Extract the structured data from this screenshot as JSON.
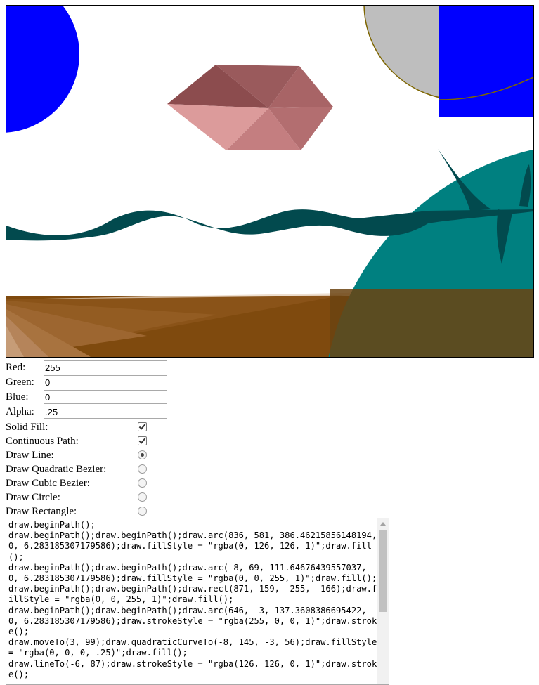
{
  "canvas": {
    "colors": {
      "teal": "#008080",
      "dark_teal": "#024a4e",
      "blue": "#0000ff",
      "dark_blue": "#0000b4",
      "gray": "#bebebe",
      "olive_stroke": "#7e7e00",
      "brown": "#7f4a0e",
      "hex_top": "#8c4c4e",
      "hex_light": "#dc9b9b"
    }
  },
  "form": {
    "red": {
      "label": "Red:",
      "value": "255"
    },
    "green": {
      "label": "Green:",
      "value": "0"
    },
    "blue": {
      "label": "Blue:",
      "value": "0"
    },
    "alpha": {
      "label": "Alpha:",
      "value": ".25"
    }
  },
  "options": {
    "solid_fill": {
      "label": "Solid Fill:",
      "checked": true
    },
    "continuous_path": {
      "label": "Continuous Path:",
      "checked": true
    },
    "draw_line": {
      "label": "Draw Line:",
      "selected": true
    },
    "draw_quadratic": {
      "label": "Draw Quadratic Bezier:",
      "selected": false
    },
    "draw_cubic": {
      "label": "Draw Cubic Bezier:",
      "selected": false
    },
    "draw_circle": {
      "label": "Draw Circle:",
      "selected": false
    },
    "draw_rectangle": {
      "label": "Draw Rectangle:",
      "selected": false
    }
  },
  "code_output": "draw.beginPath();\ndraw.beginPath();draw.beginPath();draw.arc(836, 581, 386.46215856148194, 0, 6.283185307179586);draw.fillStyle = \"rgba(0, 126, 126, 1)\";draw.fill();\ndraw.beginPath();draw.beginPath();draw.arc(-8, 69, 111.64676439557037, 0, 6.283185307179586);draw.fillStyle = \"rgba(0, 0, 255, 1)\";draw.fill();\ndraw.beginPath();draw.beginPath();draw.rect(871, 159, -255, -166);draw.fillStyle = \"rgba(0, 0, 255, 1)\";draw.fill();\ndraw.beginPath();draw.beginPath();draw.arc(646, -3, 137.3608386695422, 0, 6.283185307179586);draw.strokeStyle = \"rgba(255, 0, 0, 1)\";draw.stroke();\ndraw.moveTo(3, 99);draw.quadraticCurveTo(-8, 145, -3, 56);draw.fillStyle = \"rgba(0, 0, 0, .25)\";draw.fill();\ndraw.lineTo(-6, 87);draw.strokeStyle = \"rgba(126, 126, 0, 1)\";draw.stroke();"
}
